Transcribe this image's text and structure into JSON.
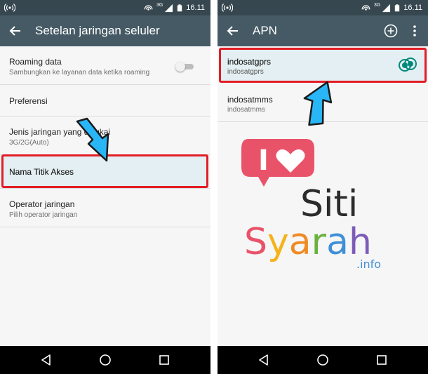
{
  "status_bar": {
    "time": "16.11",
    "network": "3G"
  },
  "left_screen": {
    "title": "Setelan jaringan seluler",
    "items": [
      {
        "title": "Roaming data",
        "subtitle": "Sambungkan ke layanan data ketika roaming",
        "toggle": "off"
      },
      {
        "title": "Preferensi",
        "subtitle": ""
      },
      {
        "title": "Jenis jaringan yang disukai",
        "subtitle": "3G/2G(Auto)"
      },
      {
        "title": "Nama Titik Akses",
        "subtitle": ""
      },
      {
        "title": "Operator jaringan",
        "subtitle": "Pilih operator jaringan"
      }
    ]
  },
  "right_screen": {
    "title": "APN",
    "apns": [
      {
        "name": "indosatgprs",
        "value": "indosatgprs",
        "selected": true
      },
      {
        "name": "indosatmms",
        "value": "indosatmms",
        "selected": false
      }
    ]
  },
  "watermark": {
    "line1_letter": "I",
    "line2": "Siti",
    "line3": "Syarah",
    "line4": ".info"
  },
  "colors": {
    "status_bar": "#37474f",
    "app_bar": "#455a64",
    "accent": "#00897b",
    "highlight_border": "#e31c25",
    "arrow": "#29b6f6",
    "heart": "#e9536a"
  },
  "icons": {
    "back": "arrow-left-icon",
    "add": "add-circle-icon",
    "more": "more-vert-icon",
    "nav_back": "nav-back-icon",
    "nav_home": "nav-home-icon",
    "nav_recent": "nav-recent-icon"
  }
}
